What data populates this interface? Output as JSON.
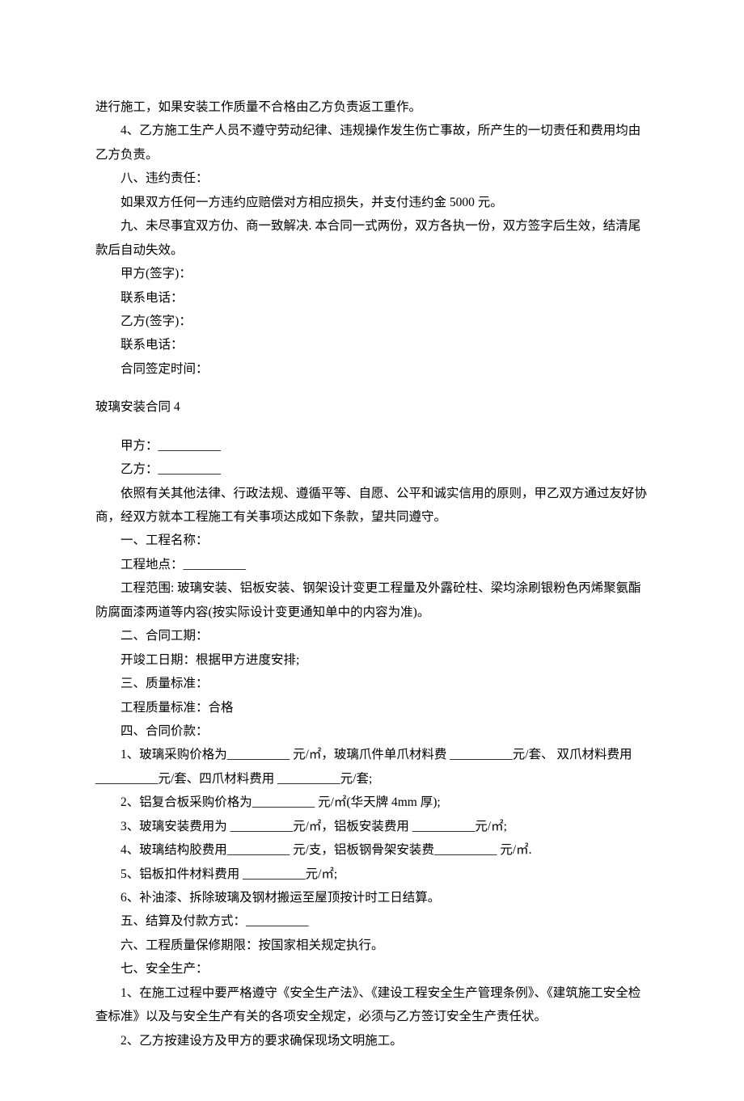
{
  "top_fragment": [
    "进行施工，如果安装工作质量不合格由乙方负责返工重作。",
    "4、乙方施工生产人员不遵守劳动纪律、违规操作发生伤亡事故，所产生的一切责任和费用均由乙方负责。",
    "八、违约责任：",
    "如果双方任何一方违约应赔偿对方相应损失，并支付违约金 5000 元。",
    "九、未尽事宜双方仂、商一致解决. 本合同一式两份，双方各执一份，双方签字后生效，结清尾款后自动失效。",
    "甲方(签字)：",
    "联系电话：",
    "乙方(签字)：",
    "联系电话：",
    "合同签定时间："
  ],
  "contract4_title": "玻璃安装合同 4",
  "contract4_body": [
    "甲方：__________",
    "乙方：__________",
    "依照有关其他法律、行政法规、遵循平等、自愿、公平和诚实信用的原则，甲乙双方通过友好协商，经双方就本工程施工有关事项达成如下条款，望共同遵守。",
    "一、工程名称：",
    "工程地点：__________",
    "工程范围: 玻璃安装、铝板安装、钢架设计变更工程量及外露砼柱、梁均涂刷银粉色丙烯聚氨酯防腐面漆两道等内容(按实际设计变更通知单中的内容为准)。",
    "二、合同工期：",
    "开竣工日期：根据甲方进度安排;",
    "三、质量标准：",
    "工程质量标准：合格",
    "四、合同价款：",
    "1、玻璃采购价格为__________ 元/㎡，玻璃爪件单爪材料费 __________元/套、 双爪材料费用 __________元/套、四爪材料费用 __________元/套;",
    "2、铝复合板采购价格为__________ 元/㎡(华天牌 4mm 厚);",
    "3、玻璃安装费用为 __________元/㎡，铝板安装费用 __________元/㎡;",
    "4、玻璃结构胶费用__________ 元/支，铝板钢骨架安装费__________ 元/㎡.",
    "5、铝板扣件材料费用 __________元/㎡;",
    "6、补油漆、拆除玻璃及钢材搬运至屋顶按计时工日结算。",
    "五、结算及付款方式：__________",
    "六、工程质量保修期限：按国家相关规定执行。",
    "七、安全生产：",
    "1、在施工过程中要严格遵守《安全生产法》、《建设工程安全生产管理条例》、《建筑施工安全检查标准》以及与安全生产有关的各项安全规定，必须与乙方签订安全生产责任状。",
    "2、乙方按建设方及甲方的要求确保现场文明施工。"
  ]
}
